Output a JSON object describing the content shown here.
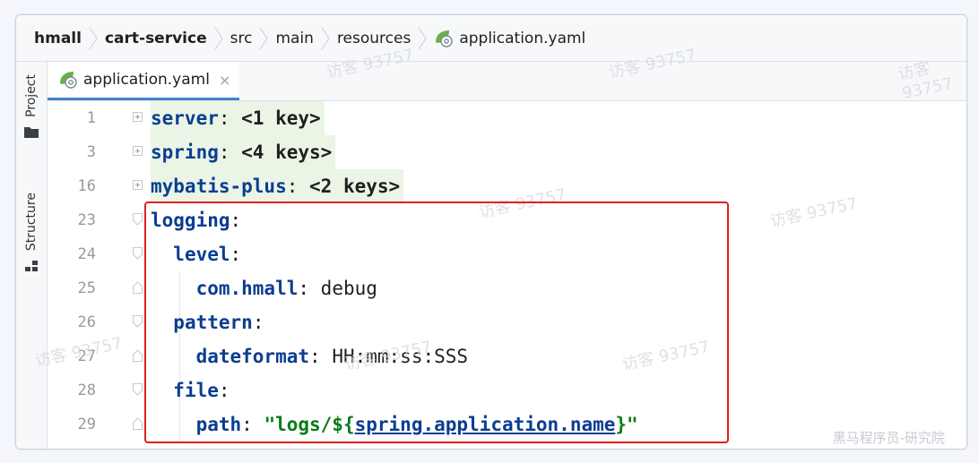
{
  "breadcrumb": {
    "items": [
      "hmall",
      "cart-service",
      "src",
      "main",
      "resources",
      "application.yaml"
    ]
  },
  "sidebar": {
    "project_label": "Project",
    "structure_label": "Structure"
  },
  "tabs": [
    {
      "label": "application.yaml",
      "close": "×"
    }
  ],
  "editor": {
    "lines": [
      {
        "num": "1",
        "key": "server",
        "folded": "<1 key>"
      },
      {
        "num": "3",
        "key": "spring",
        "folded": "<4 keys>"
      },
      {
        "num": "16",
        "key": "mybatis-plus",
        "folded": "<2 keys>"
      },
      {
        "num": "23",
        "key": "logging"
      },
      {
        "num": "24",
        "key": "level"
      },
      {
        "num": "25",
        "key": "com.hmall",
        "value": "debug"
      },
      {
        "num": "26",
        "key": "pattern"
      },
      {
        "num": "27",
        "key": "dateformat",
        "value": "HH:mm:ss:SSS"
      },
      {
        "num": "28",
        "key": "file"
      },
      {
        "num": "29",
        "key": "path",
        "value_prefix": "\"logs/${",
        "value_ref": "spring.application.name",
        "value_suffix": "}\""
      }
    ]
  },
  "watermark_text": "访客 93757",
  "corner_text": "黑马程序员-研究院",
  "colors": {
    "accent": "#4083c9",
    "highlight": "#e02020",
    "key": "#0b3d91",
    "string": "#067d17",
    "folded_bg": "#eaf5e6"
  }
}
